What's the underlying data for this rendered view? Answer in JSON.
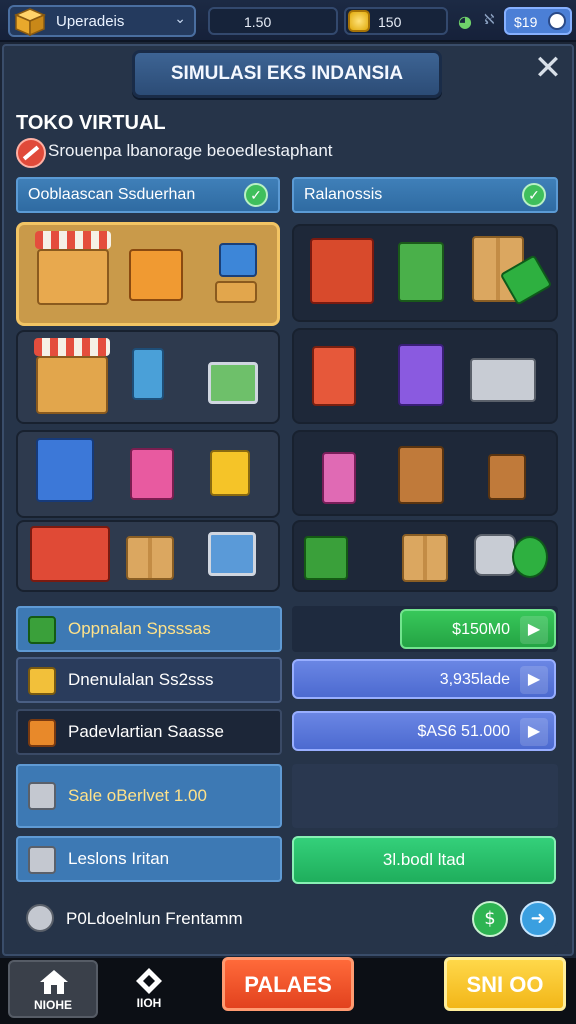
{
  "topbar": {
    "dropdown_label": "Uperadeis",
    "resource_a": "1.50",
    "resource_b": "150",
    "signal_label": "ℵ",
    "money": "$19"
  },
  "panel": {
    "title": "SIMULASI EKS INDANSIA",
    "close": "✕",
    "shop_title": "TOKO VIRTUAL",
    "shop_subtitle": "Srouenpa lbanorage beoedlestaphant"
  },
  "sections": {
    "left_header": "Ooblaascan Ssduerhan",
    "right_header": "Ralanossis"
  },
  "rows": [
    {
      "label": "Oppnalan Spsssas",
      "icon": "green-cube-icon"
    },
    {
      "label": "Dnenulalan Ss2sss",
      "icon": "gold-cube-icon"
    },
    {
      "label": "Padevlartian Saasse",
      "icon": "lantern-icon"
    },
    {
      "label": "Sale oBerlvet 1.00",
      "icon": "grey-cube-icon"
    },
    {
      "label": "Leslons Iritan",
      "icon": "grey-cube-icon"
    },
    {
      "label": "P0Ldoelnlun Frentamm",
      "icon": "helmet-icon"
    }
  ],
  "prices": {
    "btn1": "$150M0",
    "btn2": "3,935lade",
    "btn3": "$AS6 51.000",
    "btn4": "3l.bodl ltad"
  },
  "bottom_nav": {
    "home_label": "NIOHE",
    "second_label": "IIOH",
    "red_button": "PALAES",
    "yellow_button": "SNI OO"
  },
  "colors": {
    "accent_blue": "#3d79b4",
    "accent_green": "#2eb452",
    "selected_cell": "#c99a4a",
    "buy_blue": "#5670d8",
    "red_button": "#e2421e",
    "yellow_button": "#f2b618"
  }
}
